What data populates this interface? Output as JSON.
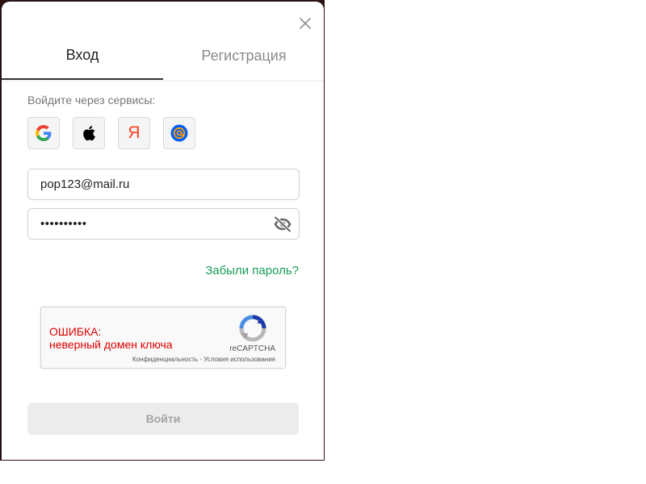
{
  "tabs": {
    "login": "Вход",
    "register": "Регистрация"
  },
  "services": {
    "label": "Войдите через сервисы:",
    "items": [
      "google-icon",
      "apple-icon",
      "yandex-icon",
      "mailru-icon"
    ],
    "yandex_glyph": "Я",
    "mailru_glyph": "@"
  },
  "form": {
    "email_value": "pop123@mail.ru",
    "password_masked": "••••••••••",
    "forgot_link": "Забыли пароль?",
    "submit_label": "Войти"
  },
  "recaptcha": {
    "error_title": "ОШИБКА:",
    "error_message": "неверный домен ключа",
    "brand": "reCAPTCHA",
    "privacy": "Конфиденциальность",
    "separator": " - ",
    "terms": "Условия использования"
  },
  "colors": {
    "link_green": "#1aa05a",
    "error_red": "#e00000",
    "yandex_red": "#fc3f1d",
    "mailru_blue": "#005ff9",
    "mailru_orange": "#ff9e00"
  }
}
